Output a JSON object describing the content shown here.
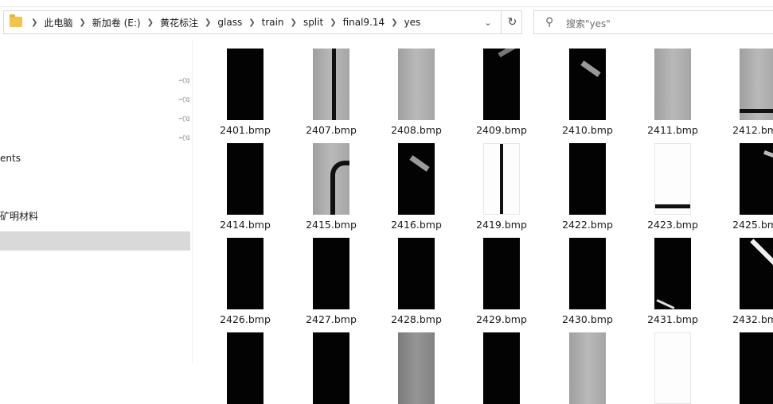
{
  "address": {
    "crumbs": [
      "此电脑",
      "新加卷 (E:)",
      "黄花标注",
      "glass",
      "train",
      "split",
      "final9.14",
      "yes"
    ],
    "dropdown_icon": "chevron-down-icon",
    "refresh_icon": "refresh-icon"
  },
  "search": {
    "placeholder": "搜索\"yes\"",
    "icon": "search-icon"
  },
  "nav": {
    "items": [
      {
        "label": "ents"
      },
      {
        "label": "矿明材料"
      }
    ],
    "pins": [
      "pin-icon",
      "pin-icon",
      "pin-icon",
      "pin-icon"
    ]
  },
  "files": {
    "rows": [
      [
        {
          "name": "2401.bmp",
          "style": "black"
        },
        {
          "name": "2407.bmp",
          "style": "gray-line"
        },
        {
          "name": "2408.bmp",
          "style": "gray"
        },
        {
          "name": "2409.bmp",
          "style": "black-corner"
        },
        {
          "name": "2410.bmp",
          "style": "black-tool"
        },
        {
          "name": "2411.bmp",
          "style": "gray"
        },
        {
          "name": "2412.bmp",
          "style": "gray-bottom"
        }
      ],
      [
        {
          "name": "2414.bmp",
          "style": "black"
        },
        {
          "name": "2415.bmp",
          "style": "gray-hook"
        },
        {
          "name": "2416.bmp",
          "style": "black-tool"
        },
        {
          "name": "2419.bmp",
          "style": "white-line"
        },
        {
          "name": "2422.bmp",
          "style": "black"
        },
        {
          "name": "2423.bmp",
          "style": "white-bar"
        },
        {
          "name": "2425.bmp",
          "style": "black-corner2"
        }
      ],
      [
        {
          "name": "2426.bmp",
          "style": "black"
        },
        {
          "name": "2427.bmp",
          "style": "black"
        },
        {
          "name": "2428.bmp",
          "style": "black"
        },
        {
          "name": "2429.bmp",
          "style": "black"
        },
        {
          "name": "2430.bmp",
          "style": "black"
        },
        {
          "name": "2431.bmp",
          "style": "black-diag"
        },
        {
          "name": "2432.bmp",
          "style": "black-diag2"
        }
      ],
      [
        {
          "name": "",
          "style": "black"
        },
        {
          "name": "",
          "style": "black"
        },
        {
          "name": "",
          "style": "dgray"
        },
        {
          "name": "",
          "style": "black"
        },
        {
          "name": "",
          "style": "gray"
        },
        {
          "name": "",
          "style": "white"
        },
        {
          "name": "",
          "style": "black"
        }
      ]
    ]
  }
}
